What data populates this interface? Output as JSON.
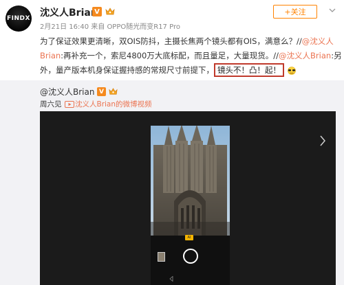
{
  "author": {
    "avatar_text": "FINDX",
    "name": "沈义人Brian",
    "v_badge": "V",
    "meta": "2月21日 16:40 来自 OPPO随光而变R17 Pro"
  },
  "actions": {
    "follow_label": "+关注"
  },
  "post": {
    "part1": "为了保证效果更清晰，双OIS防抖，主摄长焦两个镜头都有OIS，满意么？//",
    "mention1": "@沈义人Brian",
    "part2": ":再补充一个，索尼4800万大底标配，而且量足，大量现货。//",
    "mention2": "@沈义人Brian",
    "part3": ":另外，量产版本机身保证握持感的常规尺寸前提下，",
    "highlight": "镜头不！凸！起！"
  },
  "quoted": {
    "name": "@沈义人Brian",
    "v_badge": "V",
    "meta": "周六见",
    "video_link": "沈义人Brian的微博视频"
  },
  "video": {
    "mode_label": "AI"
  },
  "colors": {
    "accent": "#ff8200",
    "mention": "#eb7350",
    "highlight_border": "#c0392b",
    "verified": "#f58a1f"
  }
}
